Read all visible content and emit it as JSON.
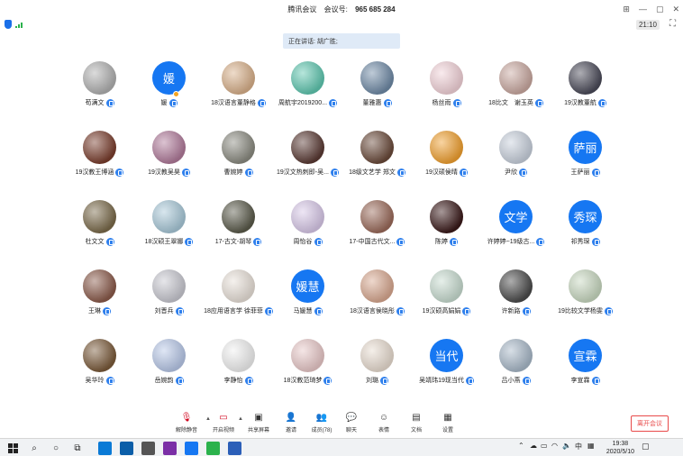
{
  "titlebar": {
    "app_name": "腾讯会议",
    "meeting_id_label": "会议号:",
    "meeting_id": "965 685 284"
  },
  "window_controls": {
    "pin": "⊞",
    "minimize": "—",
    "restore": "▢",
    "close": "✕"
  },
  "status": {
    "time": "21:10",
    "fullscreen_icon": "fullscreen-icon"
  },
  "speaking": {
    "label": "正在讲话: 胡广胜;"
  },
  "participants": [
    {
      "name": "苟满文",
      "avatar_type": "photo",
      "color": "#b0b0b0"
    },
    {
      "name": "媛",
      "avatar_type": "text",
      "avatar_text": "媛",
      "host": true
    },
    {
      "name": "18汉语言董静格",
      "avatar_type": "photo",
      "color": "#d8b08a"
    },
    {
      "name": "周航宇2019200...",
      "avatar_type": "photo",
      "color": "#5fc7b0"
    },
    {
      "name": "董雅惠",
      "avatar_type": "photo",
      "color": "#6f8aa6"
    },
    {
      "name": "杨丝雨",
      "avatar_type": "photo",
      "color": "#f2d2d8"
    },
    {
      "name": "18比文　谢玉英",
      "avatar_type": "photo",
      "color": "#c9a8a0"
    },
    {
      "name": "19汉教董航",
      "avatar_type": "photo",
      "color": "#4a4a58"
    },
    {
      "name": "19汉教王博涵",
      "avatar_type": "photo",
      "color": "#7a3e2e"
    },
    {
      "name": "19汉教吴昊",
      "avatar_type": "photo",
      "color": "#b07a9a"
    },
    {
      "name": "曹婉婷",
      "avatar_type": "photo",
      "color": "#8a8a80"
    },
    {
      "name": "19汉文热刺即-吴...",
      "avatar_type": "photo",
      "color": "#5a3a34"
    },
    {
      "name": "18级文艺学 郑文",
      "avatar_type": "photo",
      "color": "#6a4a3a"
    },
    {
      "name": "19汉硕侯晴",
      "avatar_type": "photo",
      "color": "#f0a030"
    },
    {
      "name": "尹欣",
      "avatar_type": "photo",
      "color": "#c8d0dc"
    },
    {
      "name": "王萨丽",
      "avatar_type": "text",
      "avatar_text": "萨丽"
    },
    {
      "name": "杜文文",
      "avatar_type": "photo",
      "color": "#7a6a4a"
    },
    {
      "name": "18汉硕王翠娜",
      "avatar_type": "photo",
      "color": "#a8c8d8"
    },
    {
      "name": "17-古文-胡琴",
      "avatar_type": "photo",
      "color": "#5a5a4a"
    },
    {
      "name": "周怡谷",
      "avatar_type": "photo",
      "color": "#d8c8e8"
    },
    {
      "name": "17-中国古代文...",
      "avatar_type": "photo",
      "color": "#9a6a5a"
    },
    {
      "name": "陈婷",
      "avatar_type": "photo",
      "color": "#3a1a1a"
    },
    {
      "name": "许婷婷~19级古...",
      "avatar_type": "text",
      "avatar_text": "文学"
    },
    {
      "name": "祁秀琛",
      "avatar_type": "text",
      "avatar_text": "秀琛"
    },
    {
      "name": "王琳",
      "avatar_type": "photo",
      "color": "#8a5a4a"
    },
    {
      "name": "刘晋兵",
      "avatar_type": "photo",
      "color": "#c8c8d0"
    },
    {
      "name": "18应用语言学 徐菲菲",
      "avatar_type": "photo",
      "color": "#e8e0d8"
    },
    {
      "name": "马媛慧",
      "avatar_type": "text",
      "avatar_text": "媛慧"
    },
    {
      "name": "18汉语言侯晓彤",
      "avatar_type": "photo",
      "color": "#d8a890"
    },
    {
      "name": "19汉硕高娟娟",
      "avatar_type": "photo",
      "color": "#c8dcd0"
    },
    {
      "name": "许新路",
      "avatar_type": "photo",
      "color": "#4a4a4a"
    },
    {
      "name": "19比较文学杨雯",
      "avatar_type": "photo",
      "color": "#c8d8c0"
    },
    {
      "name": "吴华玲",
      "avatar_type": "photo",
      "color": "#7a5a3a"
    },
    {
      "name": "岳婉韵",
      "avatar_type": "photo",
      "color": "#b8c8e8"
    },
    {
      "name": "李静怡",
      "avatar_type": "photo",
      "color": "#f0f0f0"
    },
    {
      "name": "18汉教范琦梦",
      "avatar_type": "photo",
      "color": "#e8c8c8"
    },
    {
      "name": "刘璐",
      "avatar_type": "photo",
      "color": "#e8dcd0"
    },
    {
      "name": "吴靖玮19现当代",
      "avatar_type": "text",
      "avatar_text": "当代"
    },
    {
      "name": "吕小燕",
      "avatar_type": "photo",
      "color": "#a8b8c8"
    },
    {
      "name": "李宣霖",
      "avatar_type": "text",
      "avatar_text": "宣霖"
    }
  ],
  "toolbar": {
    "mute": "解除静音",
    "video": "开启视频",
    "share": "共享屏幕",
    "invite": "邀请",
    "members": "成员(78)",
    "chat": "聊天",
    "emoji": "表情",
    "docs": "文档",
    "settings": "设置",
    "leave": "离开会议"
  },
  "taskbar": {
    "time": "19:38",
    "date": "2020/5/10",
    "ime": "中",
    "apps": [
      {
        "icon": "file-explorer-icon",
        "color": "#0a7ad6"
      },
      {
        "icon": "edge-icon",
        "color": "#0b5ea8"
      },
      {
        "icon": "settings-icon",
        "color": "#555555"
      },
      {
        "icon": "onenote-icon",
        "color": "#7b2fa6"
      },
      {
        "icon": "tencent-meeting-icon",
        "color": "#1677f2"
      },
      {
        "icon": "wechat-icon",
        "color": "#2bb24c"
      },
      {
        "icon": "word-icon",
        "color": "#2b5fb8"
      }
    ]
  }
}
